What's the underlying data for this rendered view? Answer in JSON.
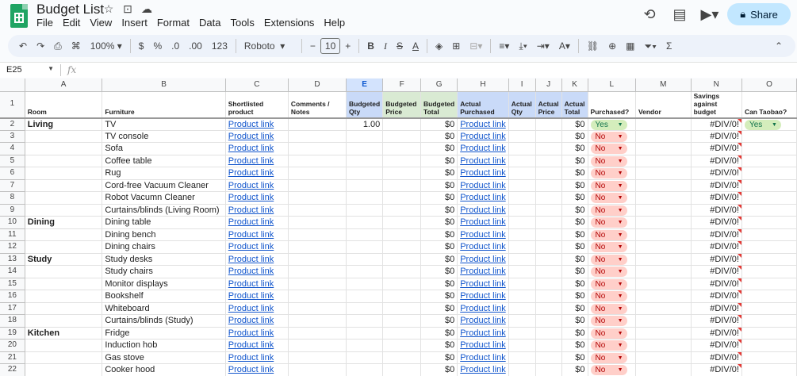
{
  "titlebar": {
    "doc_title": "Budget List",
    "share_label": "Share",
    "menu": [
      "File",
      "Edit",
      "View",
      "Insert",
      "Format",
      "Data",
      "Tools",
      "Extensions",
      "Help"
    ]
  },
  "toolbar": {
    "zoom": "100%",
    "currency": "$",
    "percent": "%",
    "dec_decrease": ".0",
    "dec_increase": ".00",
    "number_format": "123",
    "font": "Roboto",
    "font_size": "10"
  },
  "formula_bar": {
    "cell_ref": "E25",
    "fx": "fx",
    "value": ""
  },
  "columns": [
    "",
    "A",
    "B",
    "C",
    "D",
    "E",
    "F",
    "G",
    "H",
    "I",
    "J",
    "K",
    "L",
    "M",
    "N",
    "O"
  ],
  "selected_column": "E",
  "headers": [
    "Room",
    "Furniture",
    "Shortlisted product",
    "Comments / Notes",
    "Budgeted Qty",
    "Budgeted Price",
    "Budgeted Total",
    "Actual Purchased",
    "Actual Qty",
    "Actual Price",
    "Actual Total",
    "Purchased?",
    "Vendor",
    "Savings against budget",
    "Can Taobao?"
  ],
  "rows": [
    {
      "n": "2",
      "room": "Living",
      "item": "TV",
      "link": "Product link",
      "qty": "1.00",
      "btotal": "$0",
      "actual": "Product link",
      "atotal": "$0",
      "purchased": "Yes",
      "savings": "#DIV/0!",
      "taobao": "Yes"
    },
    {
      "n": "3",
      "room": "",
      "item": "TV console",
      "link": "Product link",
      "qty": "",
      "btotal": "$0",
      "actual": "Product link",
      "atotal": "$0",
      "purchased": "No",
      "savings": "#DIV/0!",
      "taobao": ""
    },
    {
      "n": "4",
      "room": "",
      "item": "Sofa",
      "link": "Product link",
      "qty": "",
      "btotal": "$0",
      "actual": "Product link",
      "atotal": "$0",
      "purchased": "No",
      "savings": "#DIV/0!",
      "taobao": ""
    },
    {
      "n": "5",
      "room": "",
      "item": "Coffee table",
      "link": "Product link",
      "qty": "",
      "btotal": "$0",
      "actual": "Product link",
      "atotal": "$0",
      "purchased": "No",
      "savings": "#DIV/0!",
      "taobao": ""
    },
    {
      "n": "6",
      "room": "",
      "item": "Rug",
      "link": "Product link",
      "qty": "",
      "btotal": "$0",
      "actual": "Product link",
      "atotal": "$0",
      "purchased": "No",
      "savings": "#DIV/0!",
      "taobao": ""
    },
    {
      "n": "7",
      "room": "",
      "item": "Cord-free Vacuum Cleaner",
      "link": "Product link",
      "qty": "",
      "btotal": "$0",
      "actual": "Product link",
      "atotal": "$0",
      "purchased": "No",
      "savings": "#DIV/0!",
      "taobao": ""
    },
    {
      "n": "8",
      "room": "",
      "item": "Robot Vacumn Cleaner",
      "link": "Product link",
      "qty": "",
      "btotal": "$0",
      "actual": "Product link",
      "atotal": "$0",
      "purchased": "No",
      "savings": "#DIV/0!",
      "taobao": ""
    },
    {
      "n": "9",
      "room": "",
      "item": "Curtains/blinds (Living Room)",
      "link": "Product link",
      "qty": "",
      "btotal": "$0",
      "actual": "Product link",
      "atotal": "$0",
      "purchased": "No",
      "savings": "#DIV/0!",
      "taobao": ""
    },
    {
      "n": "10",
      "room": "Dining",
      "item": "Dining table",
      "link": "Product link",
      "qty": "",
      "btotal": "$0",
      "actual": "Product link",
      "atotal": "$0",
      "purchased": "No",
      "savings": "#DIV/0!",
      "taobao": ""
    },
    {
      "n": "11",
      "room": "",
      "item": "Dining bench",
      "link": "Product link",
      "qty": "",
      "btotal": "$0",
      "actual": "Product link",
      "atotal": "$0",
      "purchased": "No",
      "savings": "#DIV/0!",
      "taobao": ""
    },
    {
      "n": "12",
      "room": "",
      "item": "Dining chairs",
      "link": "Product link",
      "qty": "",
      "btotal": "$0",
      "actual": "Product link",
      "atotal": "$0",
      "purchased": "No",
      "savings": "#DIV/0!",
      "taobao": ""
    },
    {
      "n": "13",
      "room": "Study",
      "item": "Study desks",
      "link": "Product link",
      "qty": "",
      "btotal": "$0",
      "actual": "Product link",
      "atotal": "$0",
      "purchased": "No",
      "savings": "#DIV/0!",
      "taobao": ""
    },
    {
      "n": "14",
      "room": "",
      "item": "Study chairs",
      "link": "Product link",
      "qty": "",
      "btotal": "$0",
      "actual": "Product link",
      "atotal": "$0",
      "purchased": "No",
      "savings": "#DIV/0!",
      "taobao": ""
    },
    {
      "n": "15",
      "room": "",
      "item": "Monitor displays",
      "link": "Product link",
      "qty": "",
      "btotal": "$0",
      "actual": "Product link",
      "atotal": "$0",
      "purchased": "No",
      "savings": "#DIV/0!",
      "taobao": ""
    },
    {
      "n": "16",
      "room": "",
      "item": "Bookshelf",
      "link": "Product link",
      "qty": "",
      "btotal": "$0",
      "actual": "Product link",
      "atotal": "$0",
      "purchased": "No",
      "savings": "#DIV/0!",
      "taobao": ""
    },
    {
      "n": "17",
      "room": "",
      "item": "Whiteboard",
      "link": "Product link",
      "qty": "",
      "btotal": "$0",
      "actual": "Product link",
      "atotal": "$0",
      "purchased": "No",
      "savings": "#DIV/0!",
      "taobao": ""
    },
    {
      "n": "18",
      "room": "",
      "item": "Curtains/blinds (Study)",
      "link": "Product link",
      "qty": "",
      "btotal": "$0",
      "actual": "Product link",
      "atotal": "$0",
      "purchased": "No",
      "savings": "#DIV/0!",
      "taobao": ""
    },
    {
      "n": "19",
      "room": "Kitchen",
      "item": "Fridge",
      "link": "Product link",
      "qty": "",
      "btotal": "$0",
      "actual": "Product link",
      "atotal": "$0",
      "purchased": "No",
      "savings": "#DIV/0!",
      "taobao": ""
    },
    {
      "n": "20",
      "room": "",
      "item": "Induction hob",
      "link": "Product link",
      "qty": "",
      "btotal": "$0",
      "actual": "Product link",
      "atotal": "$0",
      "purchased": "No",
      "savings": "#DIV/0!",
      "taobao": ""
    },
    {
      "n": "21",
      "room": "",
      "item": "Gas stove",
      "link": "Product link",
      "qty": "",
      "btotal": "$0",
      "actual": "Product link",
      "atotal": "$0",
      "purchased": "No",
      "savings": "#DIV/0!",
      "taobao": ""
    },
    {
      "n": "22",
      "room": "",
      "item": "Cooker hood",
      "link": "Product link",
      "qty": "",
      "btotal": "$0",
      "actual": "Product link",
      "atotal": "$0",
      "purchased": "No",
      "savings": "#DIV/0!",
      "taobao": ""
    }
  ],
  "colors": {
    "accent": "#0b57d0",
    "share_bg": "#c2e7ff",
    "link": "#1155cc",
    "no_chip": "#ffcfc9",
    "yes_chip": "#d4edbc"
  }
}
